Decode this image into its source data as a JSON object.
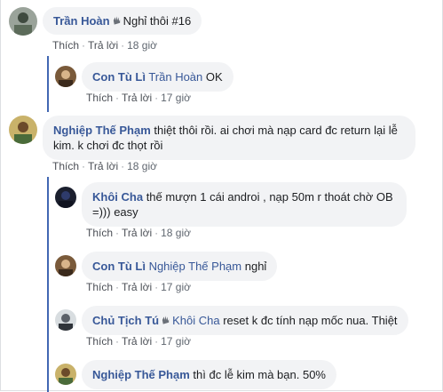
{
  "comments": [
    {
      "author": "Trần Hoàn",
      "wave": true,
      "mention": "",
      "text": "Nghỉ thôi #16",
      "actions": {
        "like": "Thích",
        "reply": "Trả lời",
        "time": "18 giờ"
      }
    },
    {
      "author": "Con Tù Lì",
      "wave": false,
      "mention": "Trần Hoàn",
      "text": "OK",
      "actions": {
        "like": "Thích",
        "reply": "Trả lời",
        "time": "17 giờ"
      }
    },
    {
      "author": "Nghiệp Thế Phạm",
      "wave": false,
      "mention": "",
      "text_line1": "thiệt thôi rồi. ai chơi mà nạp card đc return lại lễ",
      "text_line2": "kim. k chơi đc thọt rồi",
      "actions": {
        "like": "Thích",
        "reply": "Trả lời",
        "time": "18 giờ"
      }
    },
    {
      "author": "Khôi Cha",
      "wave": false,
      "mention": "",
      "text_line1": "thế mượn 1 cái androi , nạp 50m r thoát chờ OB",
      "text_line2": "=))) easy",
      "actions": {
        "like": "Thích",
        "reply": "Trả lời",
        "time": "18 giờ"
      }
    },
    {
      "author": "Con Tù Lì",
      "wave": false,
      "mention": "Nghiệp Thế Phạm",
      "text": "nghỉ",
      "actions": {
        "like": "Thích",
        "reply": "Trả lời",
        "time": "17 giờ"
      }
    },
    {
      "author": "Chủ Tịch Tú",
      "wave": true,
      "mention": "Khôi Cha",
      "text": "reset k đc tính nạp mốc nua. Thiệt",
      "actions": {
        "like": "Thích",
        "reply": "Trả lời",
        "time": "17 giờ"
      }
    },
    {
      "author": "Nghiệp Thế Phạm",
      "wave": false,
      "mention": "",
      "text": "thì đc lễ kim mà bạn. 50%",
      "actions": {}
    }
  ],
  "colors": {
    "author": "#385898",
    "bubble": "#f2f3f5",
    "thread_bar": "#4267b2",
    "meta": "#606770"
  },
  "icons": {
    "wave": "waving-hand-icon"
  }
}
